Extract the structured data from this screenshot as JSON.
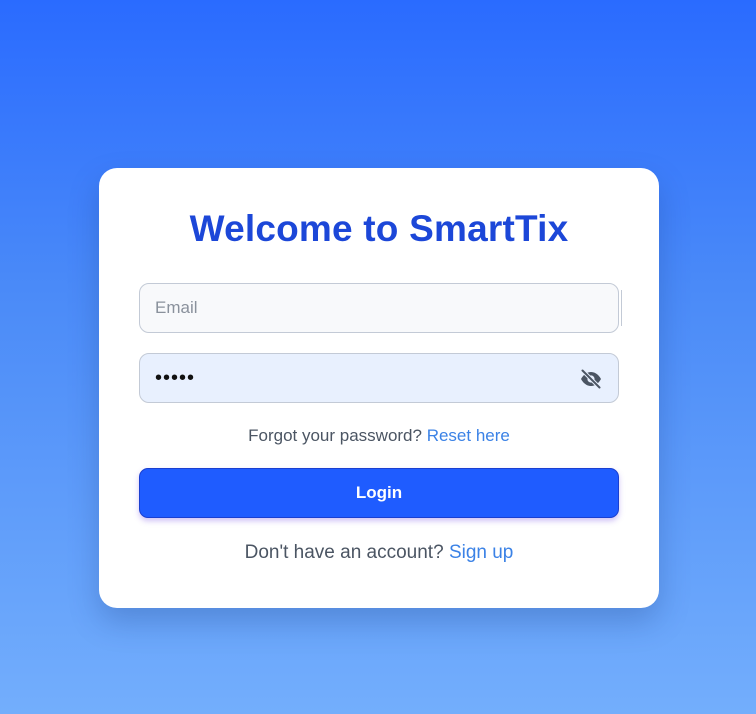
{
  "login_card": {
    "title": "Welcome to SmartTix",
    "email": {
      "placeholder": "Email",
      "value": ""
    },
    "password": {
      "value": "12345",
      "toggle_icon": "eye-slash-icon"
    },
    "forgot": {
      "text": "Forgot your password? ",
      "link_label": "Reset here"
    },
    "login_button_label": "Login",
    "signup": {
      "text": "Don't have an account? ",
      "link_label": "Sign up"
    }
  },
  "colors": {
    "title": "#1c47d8",
    "button": "#1f5cff",
    "link": "#3b82e6",
    "background_top": "#2a6bff",
    "background_bottom": "#73aefc"
  }
}
